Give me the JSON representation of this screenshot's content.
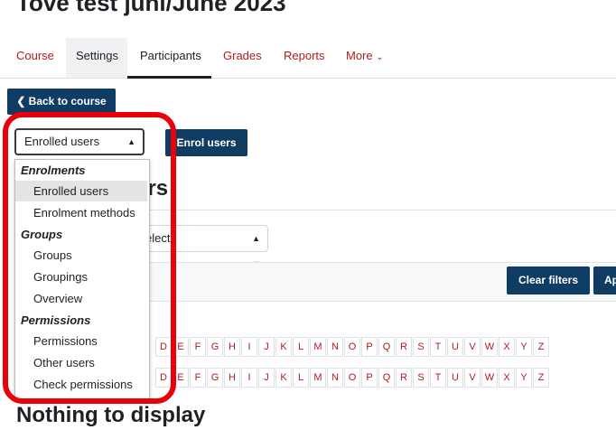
{
  "page_title": "Tove test juni/June 2023",
  "nav": {
    "tabs": [
      "Course",
      "Settings",
      "Participants",
      "Grades",
      "Reports",
      "More"
    ]
  },
  "back_button": "Back to course",
  "select_main": {
    "value": "Enrolled users"
  },
  "enrol_button": "Enrol users",
  "heading_fragment": "ers",
  "select_secondary": {
    "value": "elect"
  },
  "filters": {
    "clear_label": "Clear filters",
    "apply_label": "Ap"
  },
  "alphabet": {
    "letters": [
      "D",
      "E",
      "F",
      "G",
      "H",
      "I",
      "J",
      "K",
      "L",
      "M",
      "N",
      "O",
      "P",
      "Q",
      "R",
      "S",
      "T",
      "U",
      "V",
      "W",
      "X",
      "Y",
      "Z"
    ]
  },
  "empty_message": "Nothing to display",
  "dropdown": {
    "groups": [
      {
        "label": "Enrolments",
        "items": [
          "Enrolled users",
          "Enrolment methods"
        ]
      },
      {
        "label": "Groups",
        "items": [
          "Groups",
          "Groupings",
          "Overview"
        ]
      },
      {
        "label": "Permissions",
        "items": [
          "Permissions",
          "Other users",
          "Check permissions"
        ]
      }
    ],
    "selected": "Enrolled users"
  },
  "colors": {
    "accent_dark": "#0f3c63",
    "link_red": "#b01c1c",
    "highlight_red": "#e8000b"
  }
}
